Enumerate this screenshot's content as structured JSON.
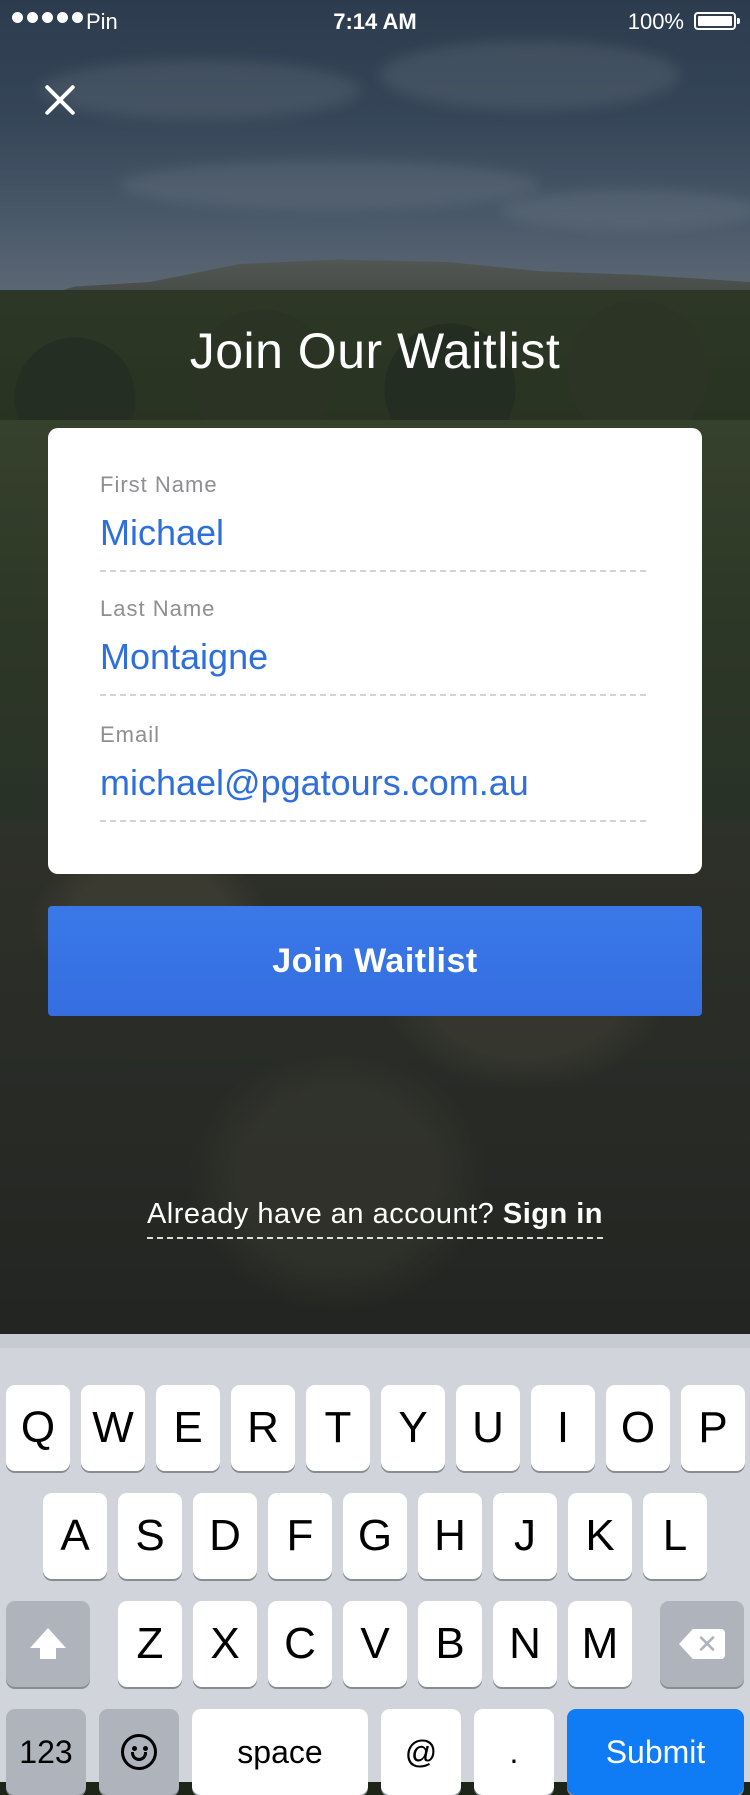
{
  "status_bar": {
    "carrier": "Pin",
    "time": "7:14 AM",
    "battery": "100%"
  },
  "header": {
    "title": "Join Our Waitlist",
    "close_icon": "close-icon"
  },
  "form": {
    "first_name": {
      "label": "First Name",
      "value": "Michael"
    },
    "last_name": {
      "label": "Last Name",
      "value": "Montaigne"
    },
    "email": {
      "label": "Email",
      "value": "michael@pgatours.com.au"
    }
  },
  "join_button": {
    "label": "Join Waitlist"
  },
  "signin": {
    "prompt": "Already have an account?",
    "link": "Sign in"
  },
  "keyboard": {
    "row1": [
      "Q",
      "W",
      "E",
      "R",
      "T",
      "Y",
      "U",
      "I",
      "O",
      "P"
    ],
    "row2": [
      "A",
      "S",
      "D",
      "F",
      "G",
      "H",
      "J",
      "K",
      "L"
    ],
    "row3": [
      "Z",
      "X",
      "C",
      "V",
      "B",
      "N",
      "M"
    ],
    "numbers_key": "123",
    "space_key": "space",
    "at_key": "@",
    "dot_key": ".",
    "submit_key": "Submit",
    "shift_icon": "shift-icon",
    "delete_icon": "delete-icon",
    "emoji_icon": "emoji-icon"
  },
  "colors": {
    "accent": "#3574e4",
    "input_text": "#2f6fdc",
    "submit_key": "#0f7bf5"
  }
}
